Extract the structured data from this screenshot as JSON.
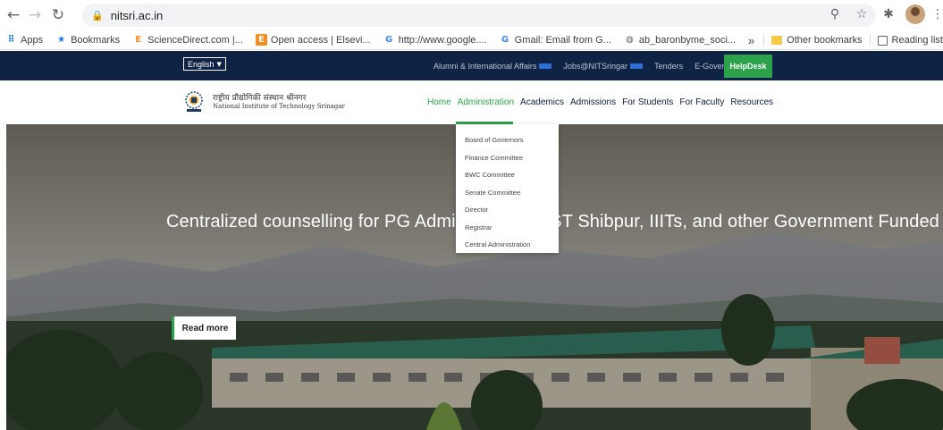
{
  "browser": {
    "url": "nitsri.ac.in",
    "bookmarks": [
      {
        "label": "Apps",
        "icon": "apps-grid-icon",
        "color": "#1a73e8"
      },
      {
        "label": "Bookmarks",
        "icon": "star-icon",
        "color": "#1a73e8"
      },
      {
        "label": "ScienceDirect.com |...",
        "icon": "elsevier-icon",
        "color": "#f68b1f"
      },
      {
        "label": "Open access | Elsevi...",
        "icon": "elsevier-icon",
        "color": "#f68b1f"
      },
      {
        "label": "http://www.google....",
        "icon": "google-icon",
        "color": "#4285f4"
      },
      {
        "label": "Gmail: Email from G...",
        "icon": "google-icon",
        "color": "#4285f4"
      },
      {
        "label": "ab_baronbyme_soci...",
        "icon": "globe-icon",
        "color": "#5f6368"
      }
    ],
    "overflow": "»",
    "other_bookmarks": "Other bookmarks",
    "reading_list": "Reading list"
  },
  "topbar": {
    "language": "English",
    "links": [
      "Alumni & International Affairs",
      "Jobs@NITSringar",
      "Tenders",
      "E-Governance"
    ],
    "helpdesk": "HelpDesk"
  },
  "header": {
    "name_hindi": "राष्ट्रीय प्रौद्योगिकी संस्थान श्रीनगर",
    "name_english": "National Institute of Technology Srinagar",
    "nav": [
      "Home",
      "Administration",
      "Academics",
      "Admissions",
      "For Students",
      "For Faculty",
      "Resources"
    ]
  },
  "dropdown": {
    "items": [
      "Board of Governors",
      "Finance Committee",
      "BWC Committee",
      "Senate Committee",
      "Director",
      "Registrar",
      "Central Administration"
    ]
  },
  "hero": {
    "headline_start": "Centralized counselling for PG Admiss",
    "headline_mid": "EST Shibpur, IIITs, and other Government Funded Tec",
    "read_more": "Read more"
  },
  "colors": {
    "accent_green": "#2ca24a",
    "topbar_navy": "#0f2444"
  }
}
